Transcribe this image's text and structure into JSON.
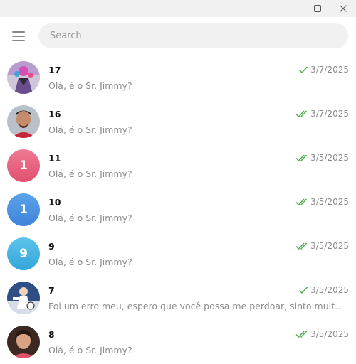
{
  "window": {
    "minimize_icon": "minimize-icon",
    "maximize_icon": "maximize-icon",
    "close_icon": "close-icon"
  },
  "header": {
    "menu_icon": "hamburger-menu-icon",
    "search_placeholder": "Search"
  },
  "colors": {
    "check_green": "#4fae4e",
    "avatar_pink": "#e8607e",
    "avatar_blue": "#4a8fe0",
    "avatar_cyan": "#3cb0de"
  },
  "chats": [
    {
      "name": "17",
      "time": "3/7/2025",
      "check": "single",
      "message": "Olá, é o Sr. Jimmy?",
      "avatar_type": "photo"
    },
    {
      "name": "16",
      "time": "3/7/2025",
      "check": "double",
      "message": "Olá, é o Sr. Jimmy?",
      "avatar_type": "photo"
    },
    {
      "name": "11",
      "time": "3/5/2025",
      "check": "double",
      "message": "Olá, é o Sr. Jimmy?",
      "avatar_type": "initial",
      "initial": "1"
    },
    {
      "name": "10",
      "time": "3/5/2025",
      "check": "double",
      "message": "Olá, é o Sr. Jimmy?",
      "avatar_type": "initial",
      "initial": "1"
    },
    {
      "name": "9",
      "time": "3/5/2025",
      "check": "double",
      "message": "Olá, é o Sr. Jimmy?",
      "avatar_type": "initial",
      "initial": "9"
    },
    {
      "name": "7",
      "time": "3/5/2025",
      "check": "single",
      "message": "Foi um erro meu, espero que você possa me perdoar, sinto muito me...",
      "avatar_type": "photo"
    },
    {
      "name": "8",
      "time": "3/5/2025",
      "check": "double",
      "message": "Olá, é o Sr. Jimmy?",
      "avatar_type": "photo"
    }
  ]
}
